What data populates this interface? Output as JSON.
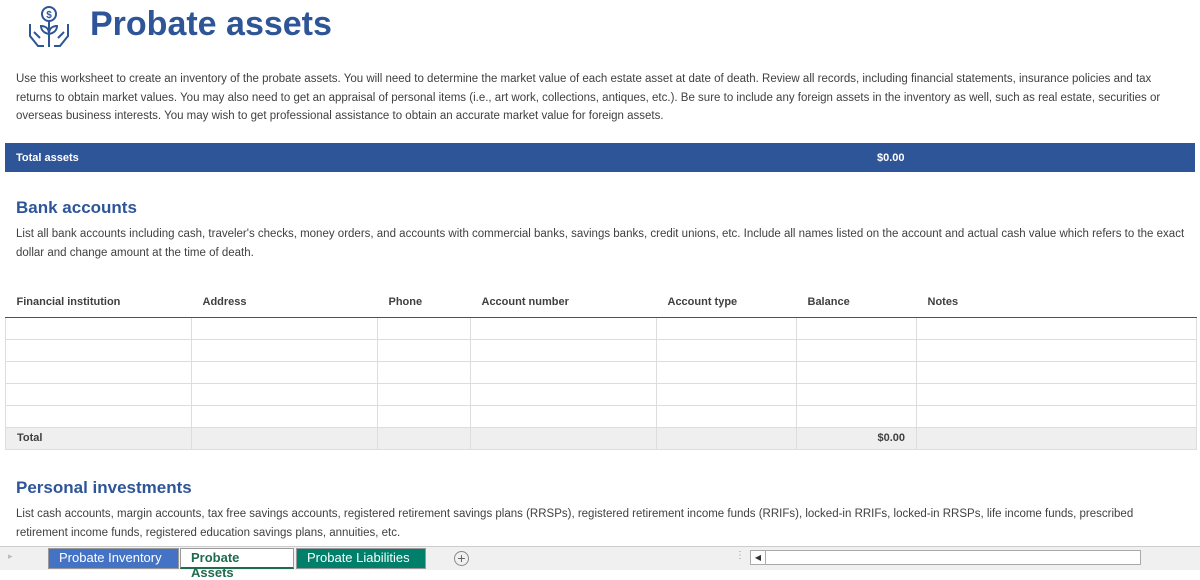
{
  "header": {
    "title": "Probate assets",
    "icon": "money-plant-hands-icon"
  },
  "intro": "Use this worksheet to create an inventory of the probate assets. You will need to determine the market value of each estate asset at date of death. Review all records, including financial statements, insurance policies and tax returns to obtain market values. You may also need to get an appraisal of personal items (i.e., art work, collections, antiques, etc.). Be sure to include any foreign assets in the inventory as well, such as real estate, securities or overseas business interests. You may wish to get professional assistance to obtain an accurate market value for foreign assets.",
  "total_assets": {
    "label": "Total assets",
    "value": "$0.00"
  },
  "bank": {
    "heading": "Bank accounts",
    "description": "List all bank accounts including cash, traveler's checks, money orders, and accounts with commercial banks, savings banks, credit unions, etc. Include all names listed on the account and actual cash value which refers to the exact dollar and change amount at the time of death.",
    "columns": [
      "Financial institution",
      "Address",
      "Phone",
      "Account number",
      "Account type",
      "Balance",
      "Notes"
    ],
    "total_label": "Total",
    "total_value": "$0.00"
  },
  "investments": {
    "heading": "Personal investments",
    "description": "List cash accounts, margin accounts, tax free savings accounts, registered retirement savings plans (RRSPs), registered retirement income funds (RRIFs), locked-in RRIFs, locked-in RRSPs, life income funds, prescribed retirement income funds, registered education savings plans, annuities, etc."
  },
  "tabs": [
    {
      "label": "Probate Inventory"
    },
    {
      "label": "Probate Assets"
    },
    {
      "label": "Probate Liabilities"
    }
  ],
  "colors": {
    "accent": "#2e5597",
    "tab_inventory": "#4472c4",
    "tab_liabilities": "#00806a"
  }
}
